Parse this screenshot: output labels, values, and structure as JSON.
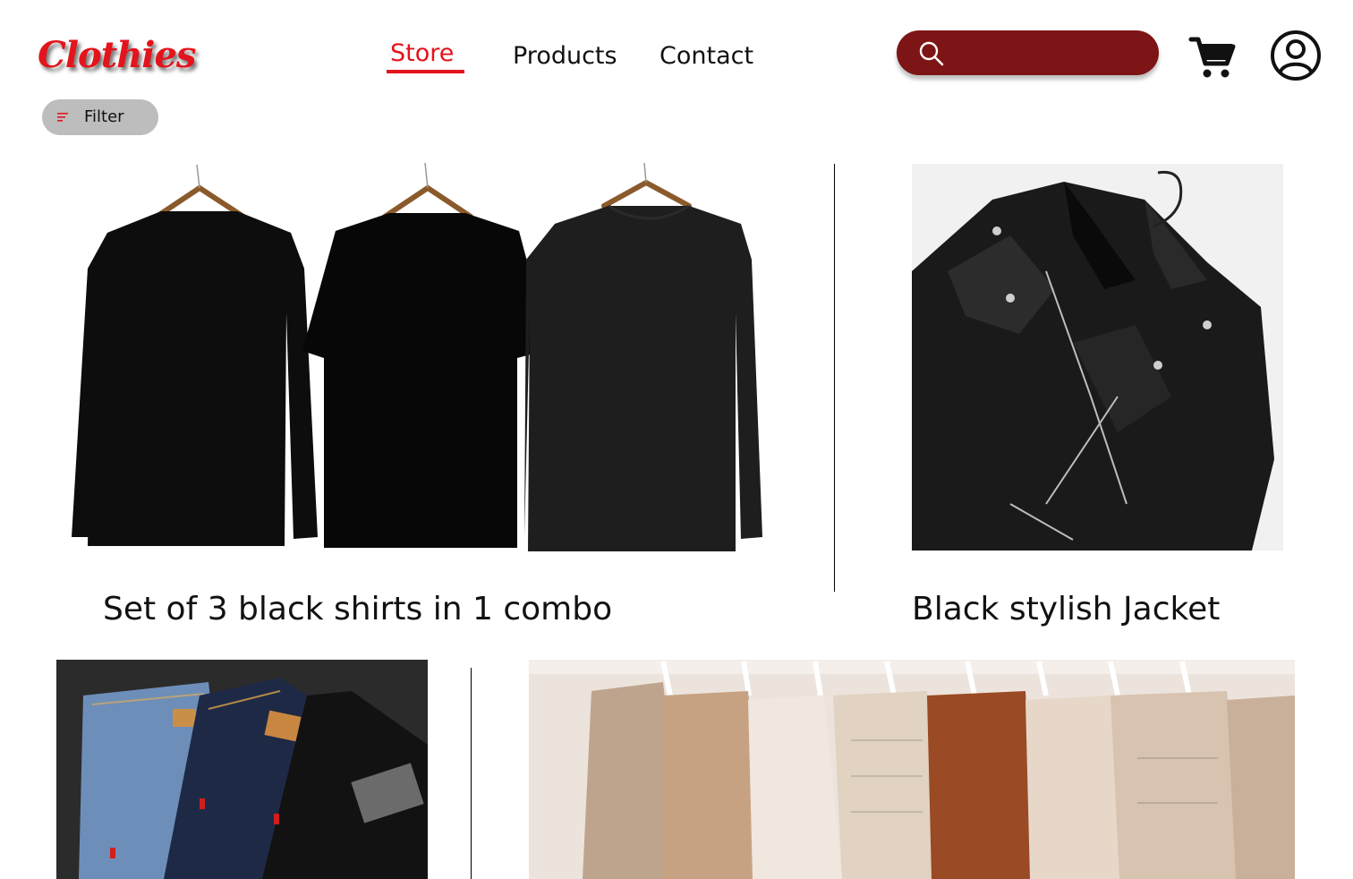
{
  "brand": {
    "name": "Clothies",
    "color": "#e3141b"
  },
  "nav": {
    "items": [
      {
        "label": "Store",
        "active": true
      },
      {
        "label": "Products",
        "active": false
      },
      {
        "label": "Contact",
        "active": false
      }
    ]
  },
  "search": {
    "placeholder": "",
    "value": "",
    "color": "#7d1416",
    "icon": "search-icon"
  },
  "header_icons": {
    "cart": "cart-icon",
    "account": "account-icon"
  },
  "filter": {
    "label": "Filter",
    "icon": "filter-icon"
  },
  "products": [
    {
      "title": "Set of 3 black shirts in 1 combo",
      "image": "three-black-shirts-on-hangers"
    },
    {
      "title": "Black stylish Jacket",
      "image": "black-leather-jacket"
    },
    {
      "title": "",
      "image": "folded-jeans"
    },
    {
      "title": "",
      "image": "sweaters-on-rack"
    }
  ]
}
